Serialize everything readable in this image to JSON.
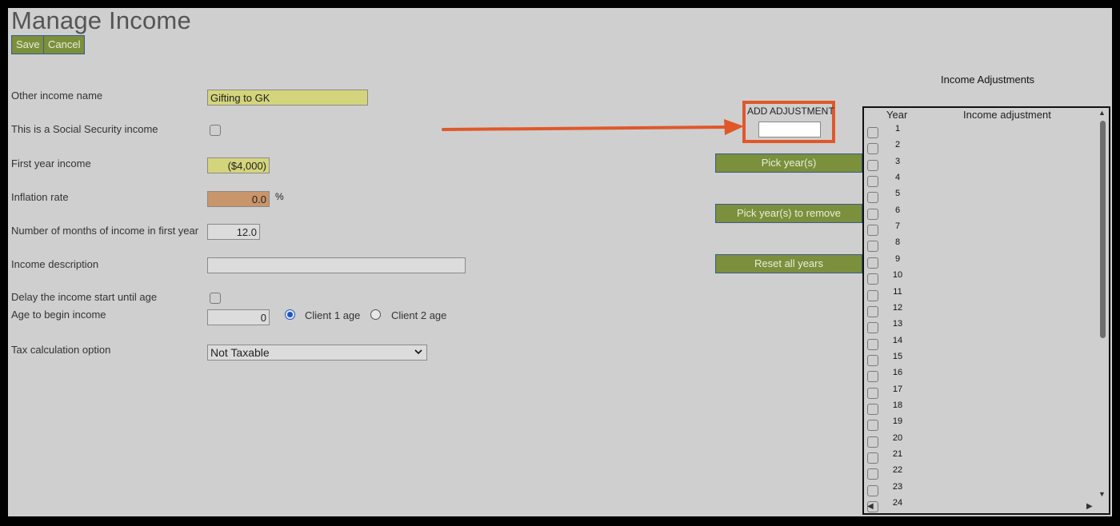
{
  "page_title": "Manage Income",
  "toolbar": {
    "save_label": "Save",
    "cancel_label": "Cancel"
  },
  "form": {
    "other_income_name_label": "Other income name",
    "other_income_name_value": "Gifting to GK",
    "social_security_label": "This is a Social Security income",
    "first_year_income_label": "First year income",
    "first_year_income_value": "($4,000)",
    "inflation_rate_label": "Inflation rate",
    "inflation_rate_value": "0.0",
    "inflation_unit": "%",
    "months_label": "Number of months of income in first year",
    "months_value": "12.0",
    "description_label": "Income description",
    "description_value": "",
    "delay_label": "Delay the income start until age",
    "age_begin_label": "Age to begin income",
    "age_begin_value": "0",
    "client1_label": "Client 1 age",
    "client2_label": "Client 2 age",
    "tax_label": "Tax calculation option",
    "tax_value": "Not Taxable"
  },
  "adjustments": {
    "add_label": "ADD ADJUSTMENT",
    "add_value": "",
    "pick_years_label": "Pick year(s)",
    "pick_remove_label": "Pick year(s) to remove",
    "reset_label": "Reset all years",
    "panel_title": "Income Adjustments",
    "col_year": "Year",
    "col_adjustment": "Income adjustment",
    "years": [
      "1",
      "2",
      "3",
      "4",
      "5",
      "6",
      "7",
      "8",
      "9",
      "10",
      "11",
      "12",
      "13",
      "14",
      "15",
      "16",
      "17",
      "18",
      "19",
      "20",
      "21",
      "22",
      "23",
      "24"
    ]
  },
  "colors": {
    "button_green": "#7b8f3d",
    "highlight_orange": "#e0582a",
    "field_yellow": "#d4d47c",
    "field_orange": "#c9956a"
  }
}
